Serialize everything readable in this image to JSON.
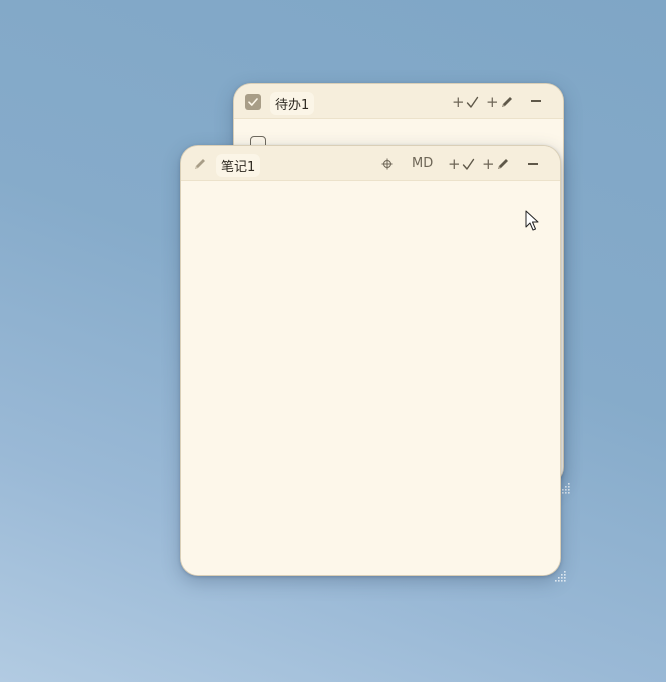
{
  "back_window": {
    "title": "待办1",
    "icon": "checkbox-checked-icon",
    "add_todo_label": "+",
    "add_note_label": "+",
    "add_todo_icon": "checkmark-icon",
    "add_note_icon": "pencil-icon",
    "minimize_icon": "minimize-icon",
    "first_item_checked": false
  },
  "front_window": {
    "title": "笔记1",
    "icon": "pencil-icon",
    "pin_icon": "crosshair-icon",
    "md_label": "MD",
    "add_todo_label": "+",
    "add_note_label": "+",
    "add_todo_icon": "checkmark-icon",
    "add_note_icon": "pencil-icon",
    "minimize_icon": "minimize-icon",
    "content": ""
  },
  "colors": {
    "desktop": "#86abca",
    "window_bg": "#fdf7ea",
    "titlebar_bg": "#f6eedc",
    "accent_check": "#a89d87"
  }
}
